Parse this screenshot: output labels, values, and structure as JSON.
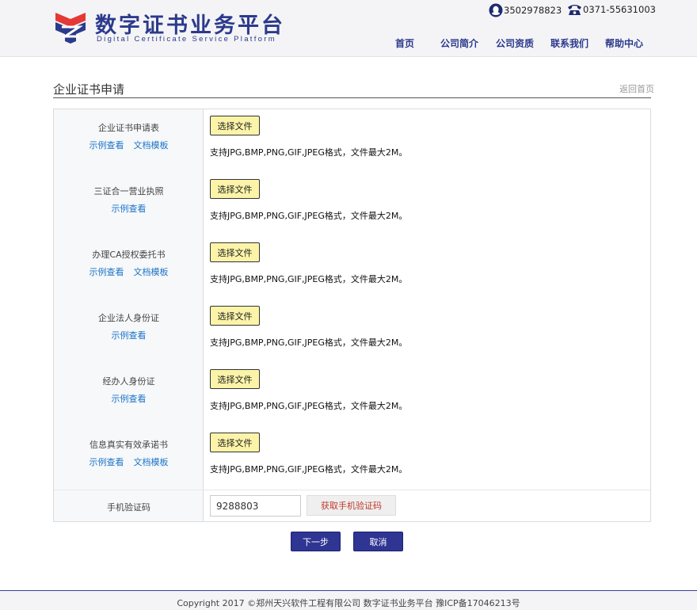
{
  "header": {
    "brand_cn": "数字证书业务平台",
    "brand_en": "Digital Certificate Service Platform",
    "qq": "3502978823",
    "phone": "0371-55631003",
    "nav": [
      "首页",
      "公司简介",
      "公司资质",
      "联系我们",
      "帮助中心"
    ]
  },
  "page": {
    "title": "企业证书申请",
    "back_link": "返回首页"
  },
  "form": {
    "file_button_label": "选择文件",
    "hint": "支持JPG,BMP,PNG,GIF,JPEG格式，文件最大2M。",
    "example_link": "示例查看",
    "template_link": "文档模板",
    "rows": [
      {
        "label": "企业证书申请表",
        "has_template": true
      },
      {
        "label": "三证合一营业执照",
        "has_template": false
      },
      {
        "label": "办理CA授权委托书",
        "has_template": true
      },
      {
        "label": "企业法人身份证",
        "has_template": false
      },
      {
        "label": "经办人身份证",
        "has_template": false
      },
      {
        "label": "信息真实有效承诺书",
        "has_template": true
      }
    ],
    "code_label": "手机验证码",
    "code_value": "9288803",
    "code_button": "获取手机验证码"
  },
  "actions": {
    "next": "下一步",
    "cancel": "取消"
  },
  "footer": {
    "text": "Copyright 2017 ©郑州天兴软件工程有限公司 数字证书业务平台 豫ICP备17046213号"
  },
  "colors": {
    "brand": "#2c3a8c",
    "link": "#1a73c8",
    "file_button": "#fbf4a8",
    "primary_button": "#2e3592"
  }
}
